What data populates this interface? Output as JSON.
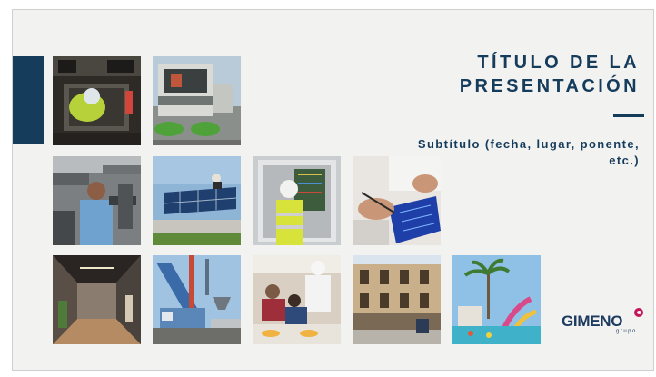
{
  "slide": {
    "title": "TÍTULO DE LA PRESENTACIÓN",
    "subtitle": "Subtítulo (fecha, lugar, ponente, etc.)"
  },
  "logo": {
    "name": "GIMENO",
    "tagline": "grupo"
  },
  "colors": {
    "brand_navy": "#163c5c",
    "logo_accent": "#c2185b",
    "slide_background": "#f2f2f1"
  },
  "photos": [
    "manhole-worker-photo",
    "street-sweeper-photo",
    "pipe-technician-photo",
    "solar-panels-photo",
    "electrical-panel-worker-photo",
    "circuit-board-photo",
    "office-corridor-photo",
    "port-crane-photo",
    "school-canteen-photo",
    "historic-building-photo",
    "water-park-photo"
  ]
}
